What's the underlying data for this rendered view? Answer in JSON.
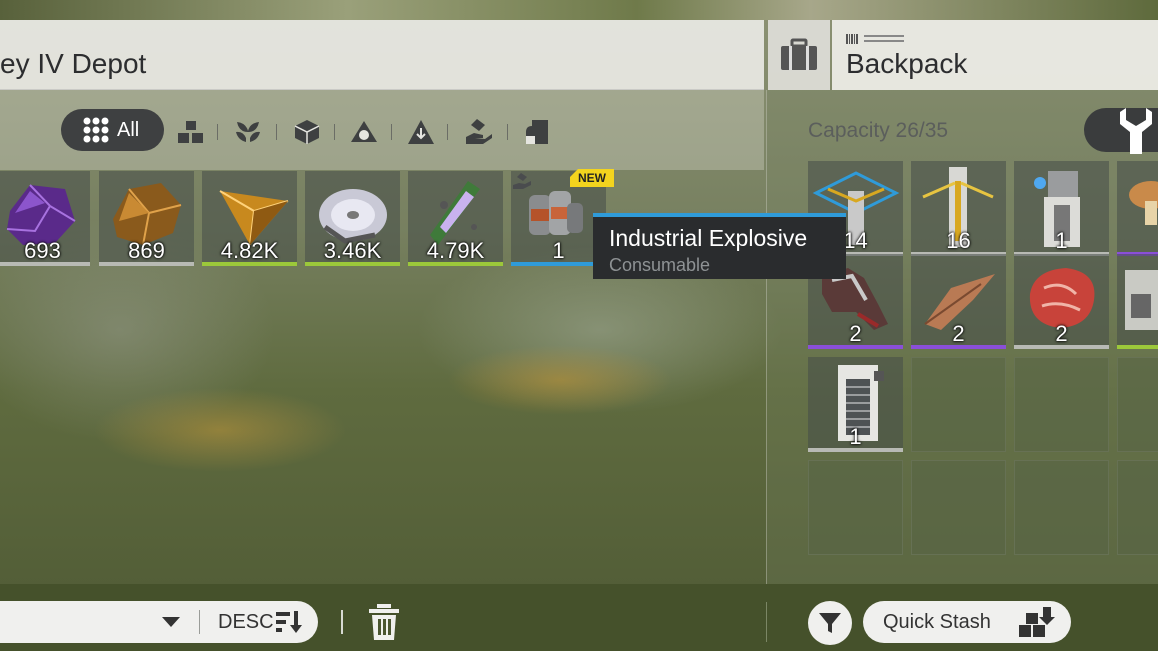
{
  "depot": {
    "title": "ey IV Depot",
    "filter_all_label": "All",
    "categories": [
      "all-icon",
      "blocks-icon",
      "plant-icon",
      "cube-icon",
      "ring-icon",
      "triangle-icon",
      "hand-icon",
      "bookmark-icon"
    ]
  },
  "backpack": {
    "title": "Backpack",
    "capacity": "Capacity 26/35"
  },
  "depot_items": [
    {
      "name": "purple-ore-item",
      "qty": "693",
      "rarity": "none"
    },
    {
      "name": "amber-ore-item",
      "qty": "869",
      "rarity": "none"
    },
    {
      "name": "amber-crystal-item",
      "qty": "4.82K",
      "rarity": "green"
    },
    {
      "name": "disc-component-item",
      "qty": "3.46K",
      "rarity": "green"
    },
    {
      "name": "circuit-board-item",
      "qty": "4.79K",
      "rarity": "green"
    },
    {
      "name": "industrial-explosive-item",
      "qty": "1",
      "rarity": "blue",
      "badge": "NEW"
    }
  ],
  "backpack_items": [
    {
      "qty": "14",
      "rarity": "none"
    },
    {
      "qty": "16",
      "rarity": "none"
    },
    {
      "qty": "1",
      "rarity": "none"
    },
    {
      "qty": "",
      "rarity": "purple"
    },
    {
      "qty": "2",
      "rarity": "purple"
    },
    {
      "qty": "2",
      "rarity": "purple"
    },
    {
      "qty": "2",
      "rarity": "none"
    },
    {
      "qty": "",
      "rarity": "green"
    },
    {
      "qty": "1",
      "rarity": "none"
    }
  ],
  "tooltip": {
    "name": "Industrial Explosive",
    "type": "Consumable"
  },
  "bottom": {
    "sort_order": "DESC",
    "quick_stash": "Quick Stash"
  },
  "colors": {
    "rarity_green": "#9cc83a",
    "rarity_blue": "#2f9bd9",
    "rarity_purple": "#8a4fd8",
    "new_badge": "#f3d41e"
  }
}
